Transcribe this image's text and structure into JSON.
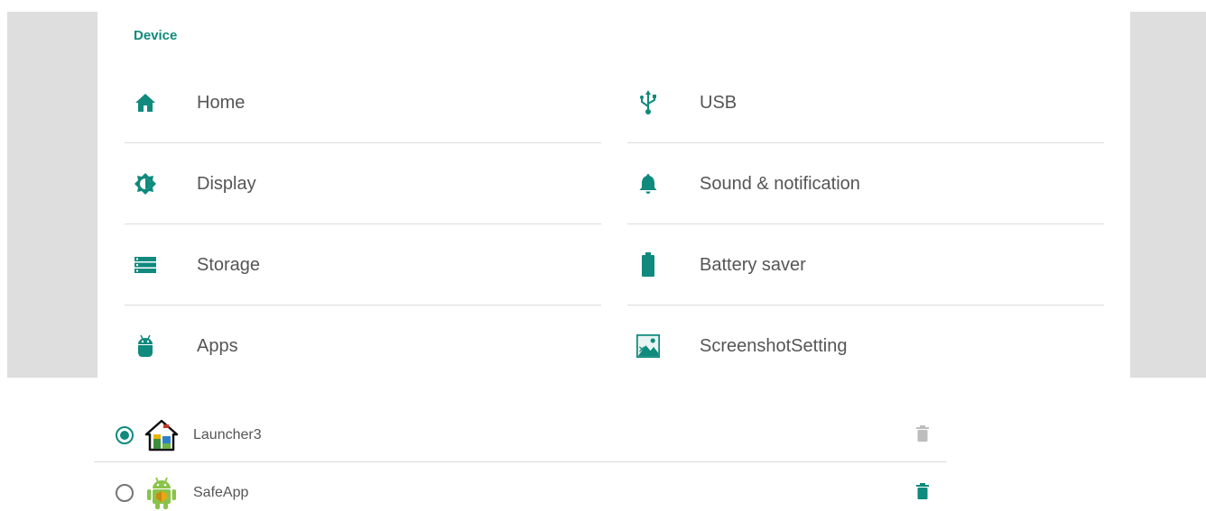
{
  "settings": {
    "section_title": "Device",
    "accent_color": "#0f8a7d",
    "items_left": [
      {
        "label": "Home",
        "icon": "home-icon"
      },
      {
        "label": "Display",
        "icon": "brightness-icon"
      },
      {
        "label": "Storage",
        "icon": "storage-icon"
      },
      {
        "label": "Apps",
        "icon": "android-icon"
      }
    ],
    "items_right": [
      {
        "label": "USB",
        "icon": "usb-icon"
      },
      {
        "label": "Sound & notification",
        "icon": "bell-icon"
      },
      {
        "label": "Battery saver",
        "icon": "battery-icon"
      },
      {
        "label": "ScreenshotSetting",
        "icon": "screenshot-icon"
      }
    ]
  },
  "home_apps": [
    {
      "name": "Launcher3",
      "selected": true,
      "icon": "launcher3-icon",
      "trash_color": "#bdbdbd"
    },
    {
      "name": "SafeApp",
      "selected": false,
      "icon": "safeapp-android-icon",
      "trash_color": "#0f8a7d"
    }
  ]
}
